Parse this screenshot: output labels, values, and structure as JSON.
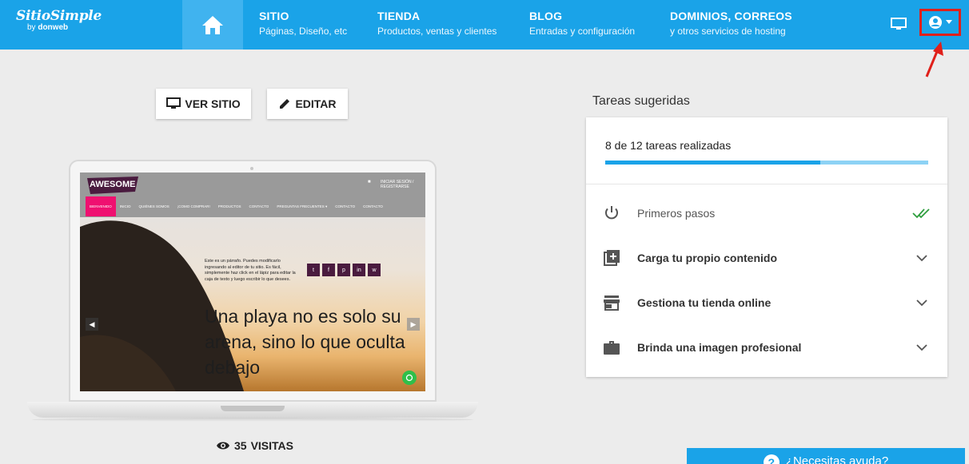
{
  "logo": {
    "brand": "SitioSimple",
    "by": "by",
    "company": "donweb"
  },
  "nav": {
    "items": [
      {
        "title": "SITIO",
        "subtitle": "Páginas, Diseño, etc"
      },
      {
        "title": "TIENDA",
        "subtitle": "Productos, ventas y clientes"
      },
      {
        "title": "BLOG",
        "subtitle": "Entradas y configuración"
      },
      {
        "title": "DOMINIOS, CORREOS",
        "subtitle": "y otros servicios de hosting"
      }
    ]
  },
  "actions": {
    "view_site": "VER SITIO",
    "edit": "EDITAR"
  },
  "preview": {
    "logo_text": "AWESOME",
    "menu": [
      "BIENVENIDO",
      "INICIO",
      "QUIÉNES SOMOS",
      "¡COMO COMPRAR!",
      "PRODUCTOS",
      "CONTACTO",
      "PREGUNTAS FRECUENTES ▾",
      "CONTACTO",
      "CONTACTO"
    ],
    "user": "INICIAR SESIÓN / REGISTRARSE",
    "paragraph": "Este es un párrafo. Puedes modificarlo ingresando al editor de tu sitio. Es fácil, simplemente haz click en el lápiz para editar la caja de texto y luego escribir lo que desees.",
    "headline": "Una playa no es solo su arena, sino lo que oculta debajo",
    "social": [
      "t",
      "f",
      "p",
      "in",
      "w"
    ]
  },
  "visits": {
    "count": "35",
    "label": "VISITAS"
  },
  "tasks": {
    "title": "Tareas sugeridas",
    "progress_text": "8 de 12 tareas realizadas",
    "progress_fraction": 0.6667,
    "items": [
      {
        "label": "Primeros pasos",
        "icon": "power-icon",
        "done": true
      },
      {
        "label": "Carga tu propio contenido",
        "icon": "add-content-icon",
        "done": false
      },
      {
        "label": "Gestiona tu tienda online",
        "icon": "store-icon",
        "done": false
      },
      {
        "label": "Brinda una imagen profesional",
        "icon": "briefcase-icon",
        "done": false
      }
    ]
  },
  "help": {
    "label": "¿Necesitas ayuda?"
  },
  "colors": {
    "primary": "#1aa3e8",
    "highlight": "#e0201a",
    "accent_pink": "#ef1070",
    "done_green": "#2e9e3e"
  }
}
